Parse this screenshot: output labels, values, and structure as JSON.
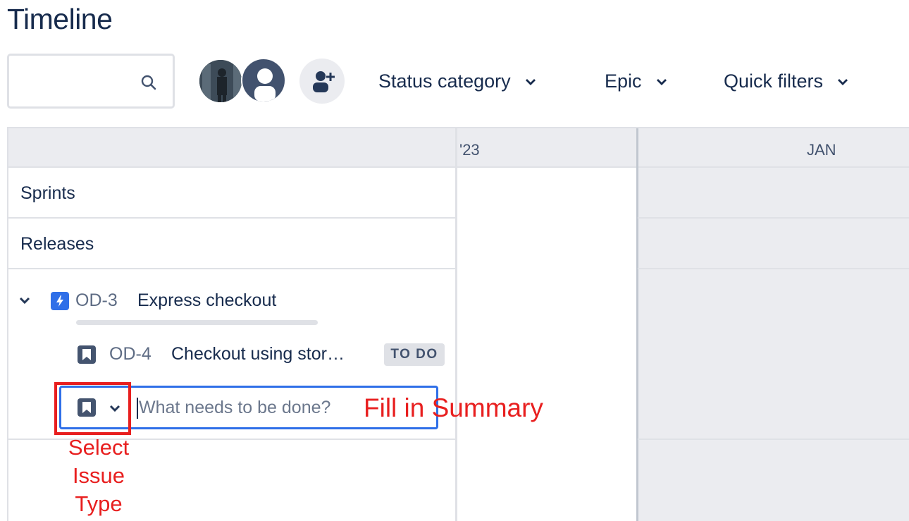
{
  "page": {
    "title": "Timeline"
  },
  "toolbar": {
    "search_placeholder": "",
    "filters": [
      {
        "label": "Status category"
      },
      {
        "label": "Epic"
      },
      {
        "label": "Quick filters"
      }
    ]
  },
  "timeline": {
    "header": {
      "year_label": "'23",
      "month_label": "JAN"
    },
    "rows": {
      "sprints_label": "Sprints",
      "releases_label": "Releases"
    },
    "epic": {
      "key": "OD-3",
      "summary": "Express checkout"
    },
    "child": {
      "key": "OD-4",
      "summary": "Checkout using stor…",
      "status": "TO DO"
    },
    "create": {
      "placeholder": "What needs to be done?"
    }
  },
  "annotations": {
    "summary_note": "Fill in Summary",
    "type_note_line1": "Select",
    "type_note_line2": "Issue",
    "type_note_line3": "Type"
  },
  "colors": {
    "accent": "#2f6fe8",
    "annotation": "#e81f1f",
    "epic_icon": "#2f6fe8",
    "story_icon": "#44546f"
  }
}
